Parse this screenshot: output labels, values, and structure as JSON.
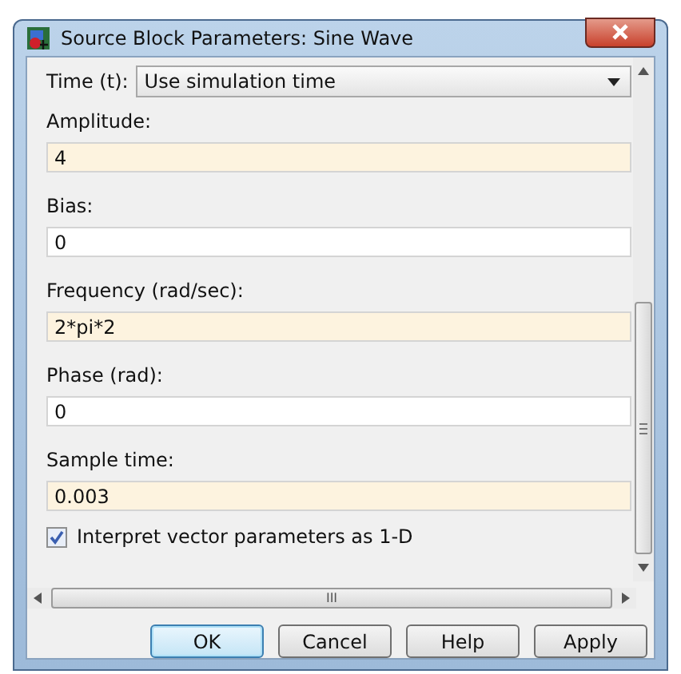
{
  "window": {
    "title": "Source Block Parameters: Sine Wave"
  },
  "time": {
    "label": "Time (t):",
    "value": "Use simulation time"
  },
  "parameters": [
    {
      "label": "Amplitude:",
      "value": "4",
      "highlighted": true
    },
    {
      "label": "Bias:",
      "value": "0",
      "highlighted": false
    },
    {
      "label": "Frequency (rad/sec):",
      "value": "2*pi*2",
      "highlighted": true
    },
    {
      "label": "Phase (rad):",
      "value": "0",
      "highlighted": false
    },
    {
      "label": "Sample time:",
      "value": "0.003",
      "highlighted": true
    }
  ],
  "checkbox": {
    "label": "Interpret vector parameters as 1-D",
    "checked": true
  },
  "hscroll_grip": "III",
  "buttons": [
    {
      "label": "OK",
      "default": true
    },
    {
      "label": "Cancel",
      "default": false
    },
    {
      "label": "Help",
      "default": false
    },
    {
      "label": "Apply",
      "default": false
    }
  ]
}
